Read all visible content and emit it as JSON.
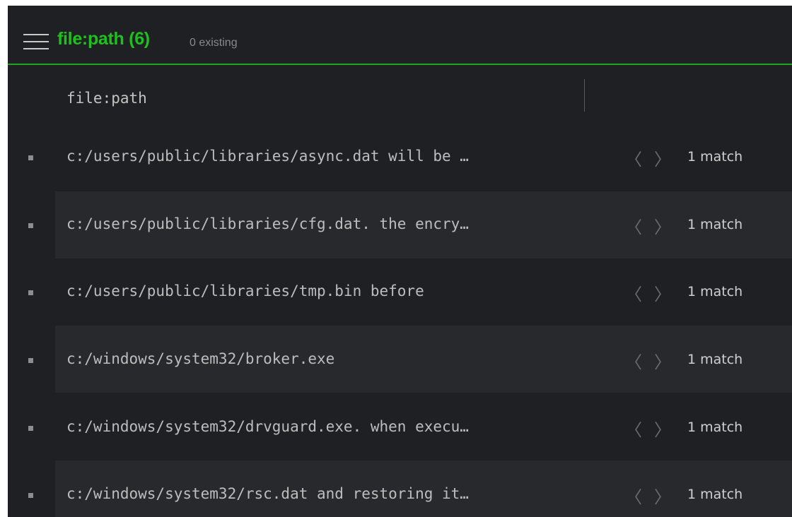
{
  "header": {
    "title": "file:path (6)",
    "subtitle": "0 existing",
    "menu_icon": "hamburger-menu-icon"
  },
  "column": {
    "label": "file:path"
  },
  "colors": {
    "accent": "#1fbf1f",
    "background": "#1f2023",
    "row_alt": "#27292c"
  },
  "rows": [
    {
      "path": "c:/users/public/libraries/async.dat will be …",
      "prev": "〈",
      "next": "〉",
      "count": "1 match"
    },
    {
      "path": "c:/users/public/libraries/cfg.dat. the encry…",
      "prev": "〈",
      "next": "〉",
      "count": "1 match"
    },
    {
      "path": "c:/users/public/libraries/tmp.bin before",
      "prev": "〈",
      "next": "〉",
      "count": "1 match"
    },
    {
      "path": "c:/windows/system32/broker.exe",
      "prev": "〈",
      "next": "〉",
      "count": "1 match"
    },
    {
      "path": "c:/windows/system32/drvguard.exe. when execu…",
      "prev": "〈",
      "next": "〉",
      "count": "1 match"
    },
    {
      "path": "c:/windows/system32/rsc.dat and restoring it…",
      "prev": "〈",
      "next": "〉",
      "count": "1 match"
    }
  ]
}
